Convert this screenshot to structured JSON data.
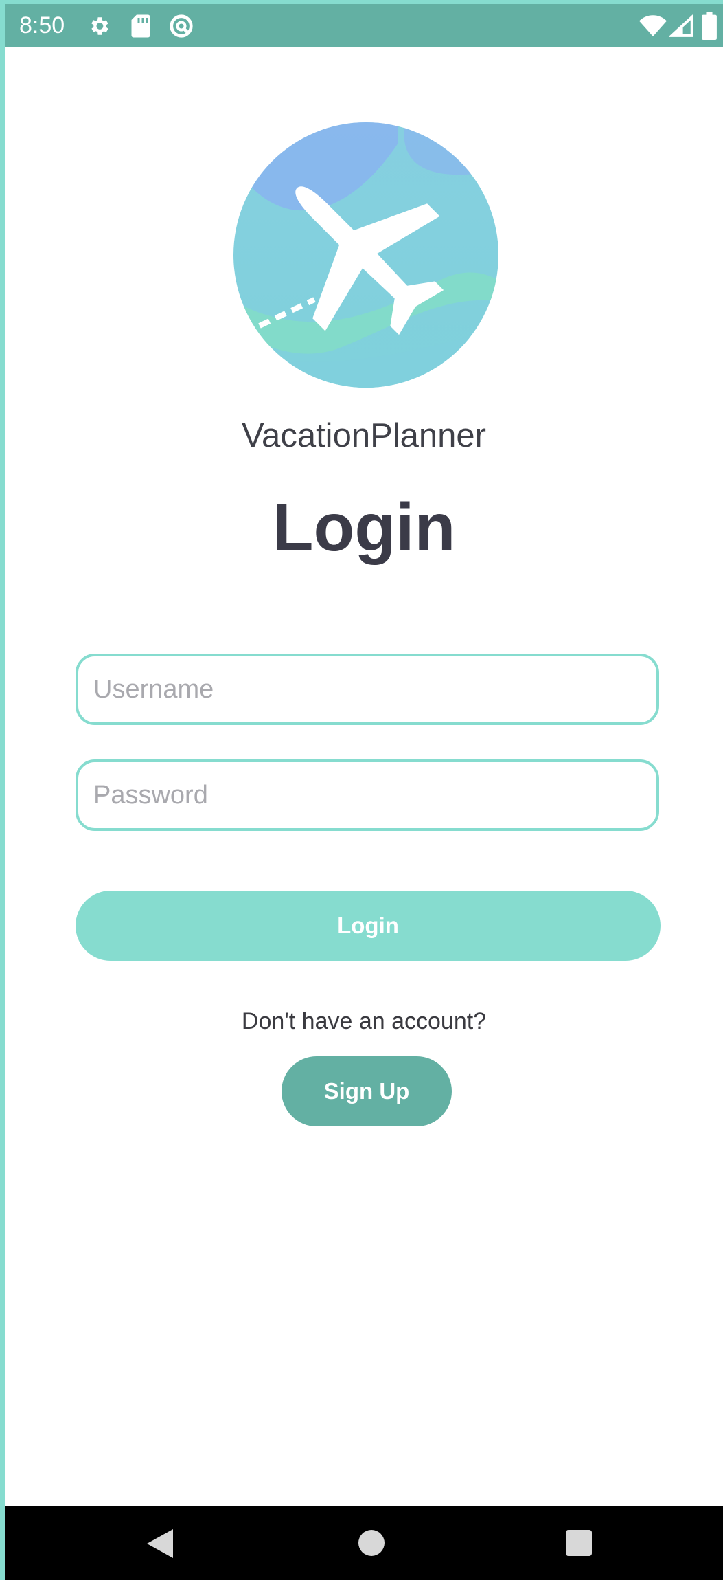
{
  "status_bar": {
    "time": "8:50",
    "icons": [
      "gear-icon",
      "sd-card-icon",
      "data-saver-icon",
      "wifi-icon",
      "signal-icon",
      "battery-icon"
    ]
  },
  "app": {
    "name": "VacationPlanner",
    "logo_icon": "airplane-icon"
  },
  "login_form": {
    "title": "Login",
    "username_placeholder": "Username",
    "password_placeholder": "Password",
    "login_label": "Login",
    "account_prompt": "Don't have an account?",
    "signup_label": "Sign Up"
  },
  "nav_bar": {
    "icons": [
      "back-icon",
      "home-icon",
      "recents-icon"
    ]
  },
  "colors": {
    "accent": "#86dccf",
    "accent_dark": "#63b0a3",
    "title_text": "#3b3b48"
  }
}
